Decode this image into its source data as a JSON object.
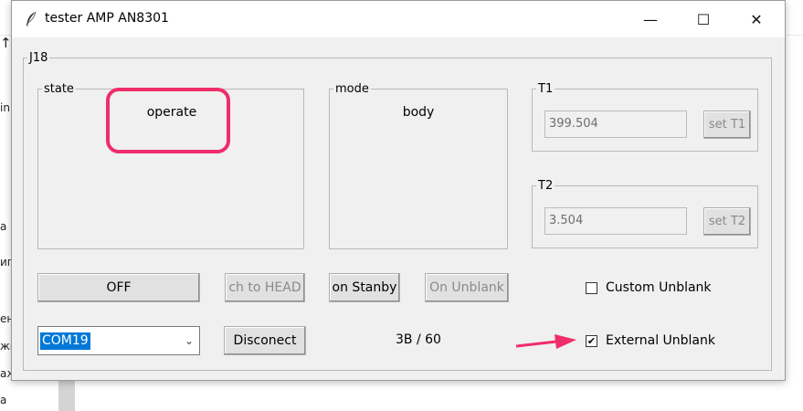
{
  "background": {
    "side_fragments": [
      "in",
      "а",
      "ип",
      "ен",
      "жи",
      "аж",
      "а"
    ],
    "arrow_glyph": "↑"
  },
  "window": {
    "title": "tester AMP AN8301",
    "icon": "feather-icon",
    "controls": {
      "minimize": "—",
      "maximize": "☐",
      "close": "✕"
    }
  },
  "j18": {
    "legend": "J18",
    "state": {
      "legend": "state",
      "value": "operate"
    },
    "mode": {
      "legend": "mode",
      "value": "body"
    },
    "t1": {
      "legend": "T1",
      "value": "399.504",
      "button": "set T1"
    },
    "t2": {
      "legend": "T2",
      "value": "3.504",
      "button": "set T2"
    }
  },
  "buttons": {
    "off": "OFF",
    "ch_to_head": "ch to HEAD",
    "on_stanby": "on Stanby",
    "on_unblank": "On Unblank",
    "disconnect": "Disconect"
  },
  "port": {
    "selected": "COM19",
    "arrow": "⌄"
  },
  "counter": "3B / 60",
  "checkboxes": {
    "custom_unblank": {
      "label": "Custom Unblank",
      "checked": false
    },
    "external_unblank": {
      "label": "External Unblank",
      "checked": true,
      "mark": "✔"
    }
  },
  "colors": {
    "annotation": "#ef2d6b",
    "selection": "#0078d7",
    "window_bg": "#f0f0f0"
  }
}
